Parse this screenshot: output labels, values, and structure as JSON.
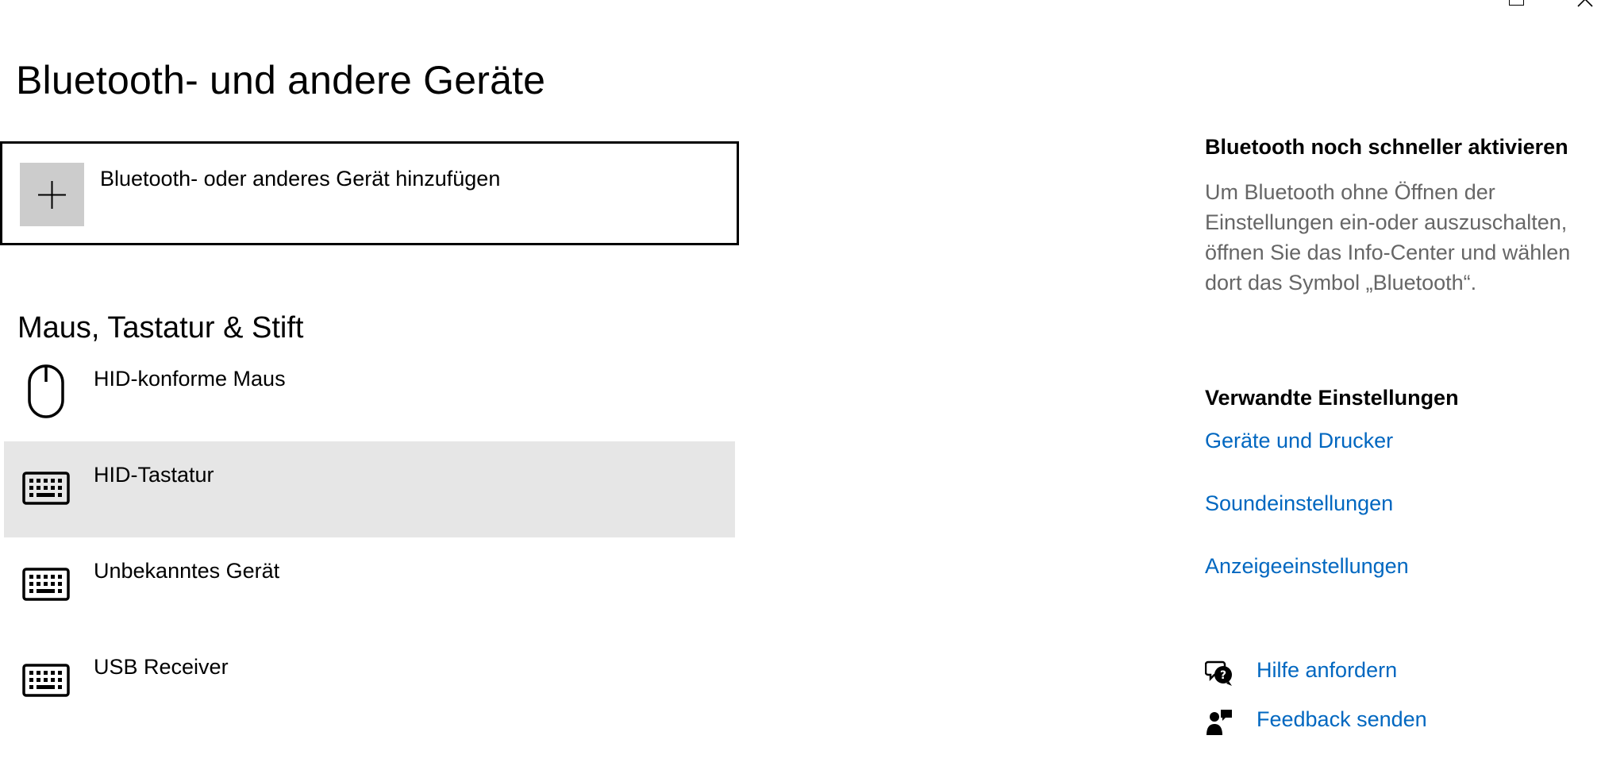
{
  "window": {
    "controls": [
      "maximize-icon",
      "close-icon"
    ]
  },
  "page": {
    "title": "Bluetooth- und andere Geräte"
  },
  "add_device": {
    "icon": "plus-icon",
    "label": "Bluetooth- oder anderes Gerät hinzufügen"
  },
  "section": {
    "heading": "Maus, Tastatur & Stift",
    "devices": [
      {
        "name": "HID-konforme Maus",
        "icon": "mouse-icon",
        "selected": false
      },
      {
        "name": "HID-Tastatur",
        "icon": "keyboard-icon",
        "selected": true
      },
      {
        "name": "Unbekanntes Gerät",
        "icon": "keyboard-icon",
        "selected": false
      },
      {
        "name": "USB Receiver",
        "icon": "keyboard-icon",
        "selected": false
      }
    ]
  },
  "sidebar": {
    "quick_heading": "Bluetooth noch schneller aktivieren",
    "quick_text": "Um Bluetooth ohne Öffnen der Einstellungen ein-oder auszuschalten, öffnen Sie das Info-Center und wählen dort das Symbol „Bluetooth“.",
    "related_heading": "Verwandte Einstellungen",
    "related_links": [
      "Geräte und Drucker",
      "Soundeinstellungen",
      "Anzeigeeinstellungen"
    ],
    "help": {
      "label": "Hilfe anfordern",
      "icon": "help-chat-icon"
    },
    "feedback": {
      "label": "Feedback senden",
      "icon": "feedback-icon"
    }
  },
  "colors": {
    "link": "#0067c0",
    "secondary_text": "#666666",
    "selected_row": "#e6e6e6",
    "add_tile": "#cccccc"
  }
}
